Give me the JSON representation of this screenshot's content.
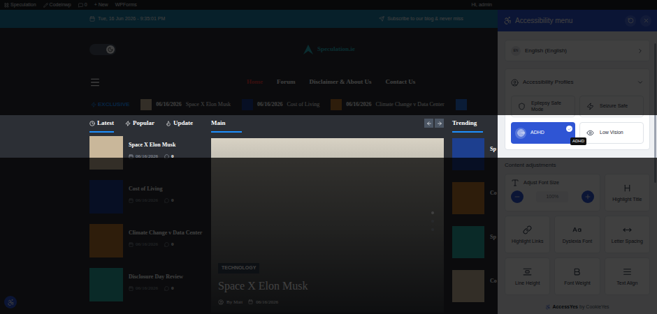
{
  "admin_bar": {
    "items": [
      "Speculation",
      "Codeinwp",
      "0",
      "+ New",
      "WPForms"
    ],
    "user": "Hi, admin"
  },
  "top_bar": {
    "date": "Tue, 16 Jun 2026 - 9:35:01 PM",
    "subscribe": "Subscribe to our blog & never miss"
  },
  "theme_toggle": {
    "dark": true
  },
  "logo": "Speculation.ie",
  "nav": [
    {
      "label": "Home",
      "selected": true
    },
    {
      "label": "Forum",
      "selected": false
    },
    {
      "label": "Disclaimer & About Us",
      "selected": false
    },
    {
      "label": "Contact Us",
      "selected": false
    }
  ],
  "ticker": {
    "label": "EXCLUSIVE",
    "items": [
      {
        "date": "06/16/2026",
        "title": "Space X Elon Musk"
      },
      {
        "date": "06/16/2026",
        "title": "Cost of Living"
      },
      {
        "date": "06/16/2026",
        "title": "Climate Change v Data Center"
      }
    ]
  },
  "tabs": [
    {
      "label": "Latest",
      "selected": true
    },
    {
      "label": "Popular",
      "selected": false
    },
    {
      "label": "Update",
      "selected": false
    }
  ],
  "latest": [
    {
      "title": "Space X Elon Musk",
      "date": "06/16/2026",
      "comments": "0"
    },
    {
      "title": "Cost of Living",
      "date": "06/16/2026",
      "comments": "0"
    },
    {
      "title": "Climate Change v Data Center",
      "date": "06/16/2026",
      "comments": "0"
    },
    {
      "title": "Disclosure Day Review",
      "date": "06/16/2026",
      "comments": "0"
    }
  ],
  "main": {
    "label": "Main",
    "slide": {
      "category": "TECHNOLOGY",
      "title": "Space X Elon Musk",
      "author": "By Matt",
      "date": "06/16/2026"
    },
    "dots": [
      {
        "selected": true
      },
      {
        "selected": false
      },
      {
        "selected": false
      }
    ]
  },
  "trending": {
    "label": "Trending",
    "items": [
      "Sp",
      "Co",
      "Sp",
      "Co"
    ]
  },
  "panel": {
    "title": "Accessibility menu",
    "language": {
      "code": "EN",
      "label": "English (English)"
    },
    "profiles": {
      "title": "Accessibility Profiles",
      "expanded": true,
      "items": [
        {
          "label": "Epilepsy Safe Mode",
          "selected": false
        },
        {
          "label": "Seizure Safe",
          "selected": false
        },
        {
          "label": "ADHD",
          "selected": true
        },
        {
          "label": "Low Vision",
          "selected": false
        }
      ]
    },
    "tooltip": "ADHD",
    "content_title": "Content adjustments",
    "tools": [
      {
        "label": "Adjust Font Size",
        "kind": "stepper",
        "value": "100%"
      },
      {
        "label": "Highlight Title",
        "kind": "toggle"
      },
      {
        "label": "Highlight Links",
        "kind": "toggle"
      },
      {
        "label": "Dyslexia Font",
        "kind": "toggle"
      },
      {
        "label": "Letter Spacing",
        "kind": "toggle"
      },
      {
        "label": "Line Height",
        "kind": "toggle"
      },
      {
        "label": "Font Weight",
        "kind": "toggle"
      },
      {
        "label": "Text Align",
        "kind": "toggle"
      }
    ],
    "footer": {
      "brand": "AccessYes",
      "by": "by CookieYes"
    }
  }
}
